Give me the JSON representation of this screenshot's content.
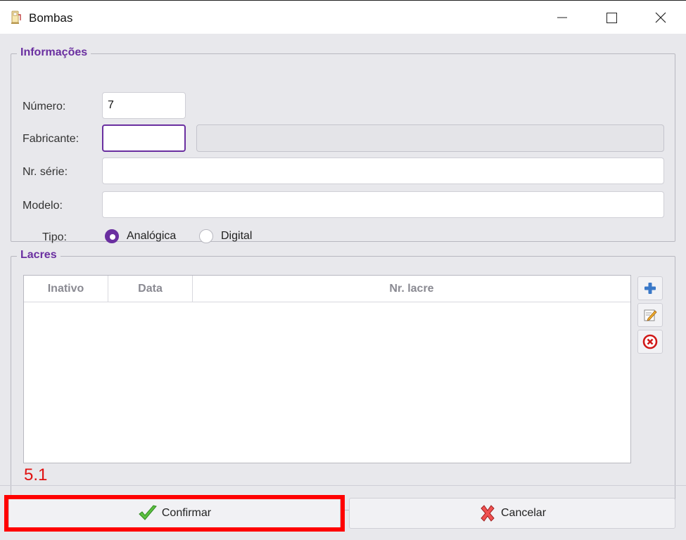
{
  "window": {
    "title": "Bombas",
    "minimize_icon": "minimize-icon",
    "maximize_icon": "maximize-icon",
    "close_icon": "close-icon"
  },
  "informacoes": {
    "title": "Informações",
    "numero": {
      "label": "Número:",
      "value": "7"
    },
    "fabricante": {
      "label": "Fabricante:",
      "code_value": "",
      "name_value": ""
    },
    "nr_serie": {
      "label": "Nr. série:",
      "value": ""
    },
    "modelo": {
      "label": "Modelo:",
      "value": ""
    },
    "tipo": {
      "label": "Tipo:",
      "options": [
        {
          "label": "Analógica",
          "selected": true
        },
        {
          "label": "Digital",
          "selected": false
        }
      ]
    }
  },
  "lacres": {
    "title": "Lacres",
    "columns": [
      "Inativo",
      "Data",
      "Nr. lacre"
    ],
    "rows": [],
    "actions": [
      {
        "name": "add-lacre-button",
        "icon": "plus-icon"
      },
      {
        "name": "edit-lacre-button",
        "icon": "edit-icon"
      },
      {
        "name": "delete-lacre-button",
        "icon": "delete-icon"
      }
    ]
  },
  "annotation": "5.1",
  "footer": {
    "confirm_label": "Confirmar",
    "cancel_label": "Cancelar"
  },
  "colors": {
    "accent": "#6a2fa0",
    "highlight": "#ff0000"
  }
}
